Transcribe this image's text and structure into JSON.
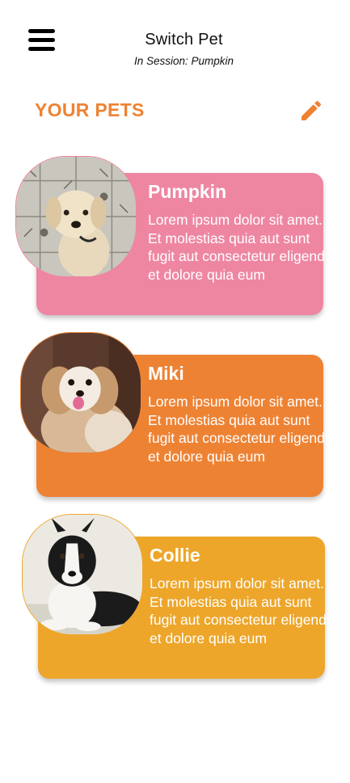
{
  "header": {
    "title": "Switch Pet",
    "subtitle": "In Session: Pumpkin",
    "menu_icon": "hamburger-menu-icon"
  },
  "section": {
    "heading": "YOUR PETS",
    "edit_icon": "pencil-icon",
    "accent_color": "#EE8233"
  },
  "pets": [
    {
      "name": "Pumpkin",
      "description": "Lorem ipsum dolor sit amet. Et molestias quia aut sunt fugit aut consectetur eligendi et dolore quia eum",
      "card_color": "#EE86A2",
      "photo": "cream-dog-on-tile-floor"
    },
    {
      "name": "Miki",
      "description": "Lorem ipsum dolor sit amet. Et molestias quia aut sunt fugit aut consectetur eligendi et dolore quia eum",
      "card_color": "#EE8233",
      "photo": "shih-tzu-dog"
    },
    {
      "name": "Collie",
      "description": "Lorem ipsum dolor sit amet. Et molestias quia aut sunt fugit aut consectetur eligendi et dolore quia eum",
      "card_color": "#EDA62A",
      "photo": "black-white-border-collie"
    }
  ]
}
